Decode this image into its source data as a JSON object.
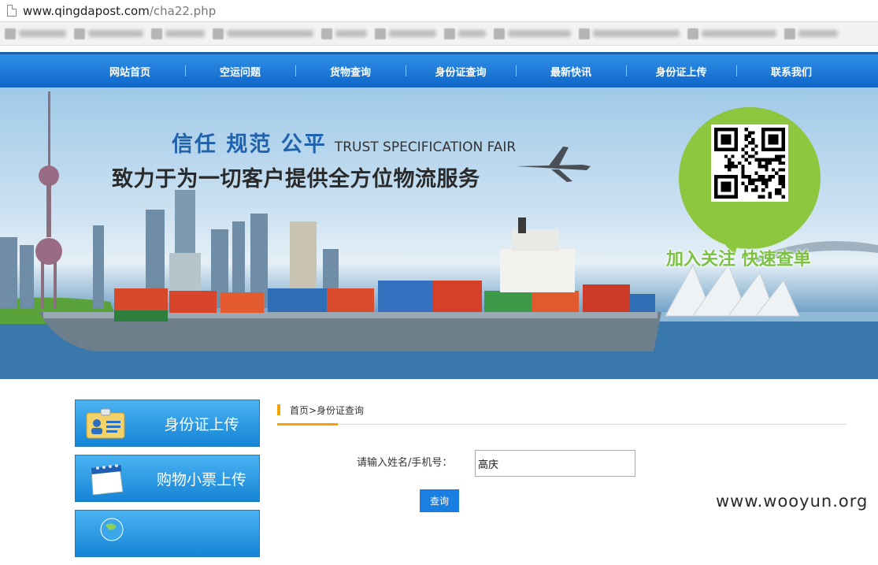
{
  "browser": {
    "url_host": "www.qingdapost.com",
    "url_path": "/cha22.php",
    "bookmarks": [
      {
        "w": 60
      },
      {
        "w": 70
      },
      {
        "w": 50
      },
      {
        "w": 110
      },
      {
        "w": 40
      },
      {
        "w": 60
      },
      {
        "w": 35
      },
      {
        "w": 80
      },
      {
        "w": 110
      },
      {
        "w": 95
      },
      {
        "w": 50
      }
    ]
  },
  "nav": {
    "items": [
      "网站首页",
      "空运问题",
      "货物查询",
      "身份证查询",
      "最新快讯",
      "身份证上传",
      "联系我们"
    ]
  },
  "banner": {
    "slogan_cn": "信任 规范 公平",
    "slogan_en": "TRUST SPECIFICATION FAIR",
    "tagline": "致力于为一切客户提供全方位物流服务",
    "join_text": "加入关注  快速查单"
  },
  "sidebar": {
    "items": [
      "身份证上传",
      "购物小票上传",
      ""
    ]
  },
  "content": {
    "breadcrumb": "首页>身份证查询",
    "query_label": "请输入姓名/手机号：",
    "query_value": "高庆",
    "query_button": "查询"
  },
  "watermark": "www.wooyun.org",
  "colors": {
    "nav_blue": "#1a72d6",
    "accent_orange": "#f5a300",
    "button_blue": "#1a7fe0",
    "bubble_green": "#8dc63f"
  }
}
